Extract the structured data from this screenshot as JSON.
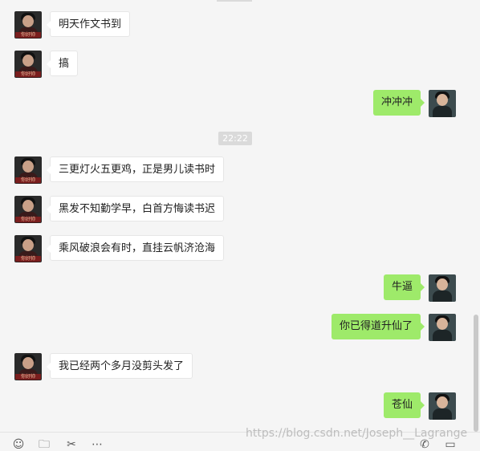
{
  "chat": {
    "timestamp": "22:22",
    "avatar_left_text": "你好帅",
    "messages": [
      {
        "side": "left",
        "text": "明天作文书到"
      },
      {
        "side": "left",
        "text": "搞"
      },
      {
        "side": "right",
        "text": "冲冲冲"
      },
      {
        "side": "left",
        "text": "三更灯火五更鸡，正是男儿读书时"
      },
      {
        "side": "left",
        "text": "黑发不知勤学早，白首方悔读书迟"
      },
      {
        "side": "left",
        "text": "乘风破浪会有时，直挂云帆济沧海"
      },
      {
        "side": "right",
        "text": "牛逼"
      },
      {
        "side": "right",
        "text": "你已得道升仙了"
      },
      {
        "side": "left",
        "text": "我已经两个多月没剪头发了"
      },
      {
        "side": "right",
        "text": "苍仙"
      }
    ]
  },
  "toolbar": {
    "icons": [
      "emoji-icon",
      "folder-icon",
      "scissors-icon",
      "more-icon",
      "phone-icon",
      "video-icon"
    ],
    "emoji": "☺",
    "folder": "🗀",
    "scissors": "✂",
    "more": "⋯",
    "phone": "✆",
    "video": "▭"
  },
  "watermark": "https://blog.csdn.net/Joseph__Lagrange",
  "colors": {
    "background": "#f5f5f5",
    "bubble_right": "#9eea6a",
    "bubble_left": "#ffffff",
    "timestamp_bg": "#dadada"
  }
}
